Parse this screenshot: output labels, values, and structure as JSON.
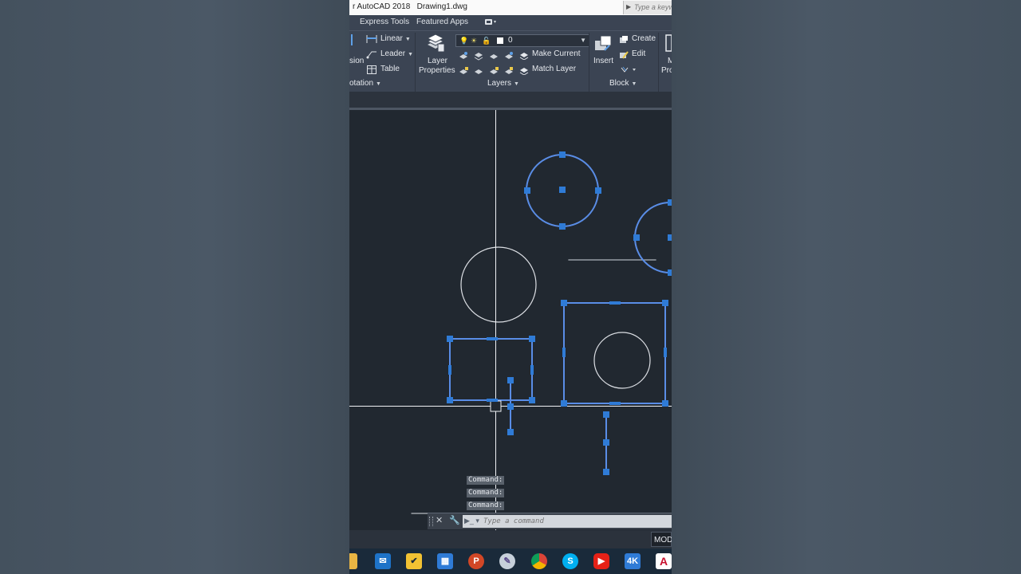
{
  "window": {
    "title": "r AutoCAD 2018   Drawing1.dwg",
    "search_placeholder": "Type a keyword"
  },
  "ribbon_tabs": [
    "Express Tools",
    "Featured Apps"
  ],
  "annotation_panel": {
    "partial_label": "sion",
    "linear": "Linear",
    "leader": "Leader",
    "table": "Table",
    "footer": "otation"
  },
  "layers_panel": {
    "current_layer": "0",
    "layer_properties_line1": "Layer",
    "layer_properties_line2": "Properties",
    "make_current": "Make Current",
    "match_layer": "Match Layer",
    "footer": "Layers"
  },
  "block_panel": {
    "insert": "Insert",
    "create": "Create",
    "edit": "Edit",
    "footer": "Block"
  },
  "partial_panel": {
    "line1": "M",
    "line2": "Pro"
  },
  "command_history": [
    "Command:",
    "Command:",
    "Command:"
  ],
  "command_line": {
    "placeholder": "Type a command"
  },
  "status": {
    "model_tab": "MOD"
  },
  "colors": {
    "canvas": "#212830",
    "selection": "#5a8de6",
    "grip": "#2f7bd6",
    "geometry": "#dcdfe4",
    "ribbon": "#3b4453"
  },
  "taskbar_icons": [
    "file-explorer",
    "mail",
    "tasks",
    "store",
    "powerpoint",
    "paint",
    "chrome",
    "skype",
    "youtube",
    "video-app",
    "autocad"
  ]
}
